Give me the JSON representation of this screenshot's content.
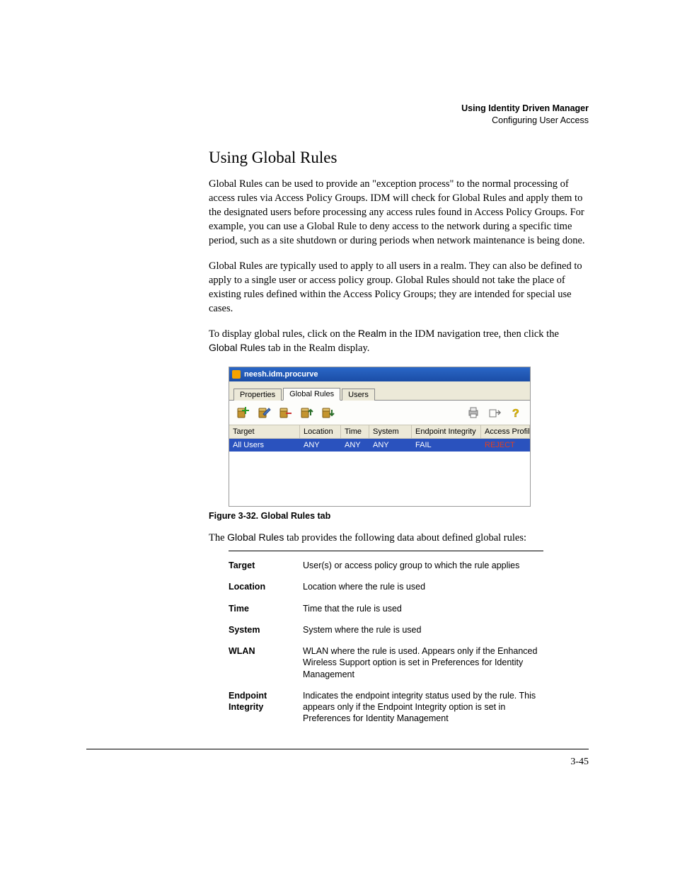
{
  "header": {
    "line1": "Using Identity Driven Manager",
    "line2": "Configuring User Access"
  },
  "section_title": "Using Global Rules",
  "paragraphs": {
    "p1": "Global Rules can be used to provide an \"exception process\" to the normal processing of access rules via Access Policy Groups. IDM will check for Global Rules and apply them to the designated users before processing any access rules found in Access Policy Groups. For example, you can use a Global Rule to deny access to the network during a specific time period, such as a site shutdown or during periods when network maintenance is being done.",
    "p2": "Global Rules are typically used to apply to all users in a realm. They can also be defined to apply to a single user or access policy group. Global Rules should not take the place of existing rules defined within the Access Policy Groups; they are intended for special use cases.",
    "p3a": "To display global rules, click on the ",
    "p3b": "Realm",
    "p3c": " in the IDM navigation tree, then click the ",
    "p3d": "Global Rules",
    "p3e": " tab in the Realm display."
  },
  "screenshot": {
    "window_title": "neesh.idm.procurve",
    "tabs": {
      "properties": "Properties",
      "global_rules": "Global Rules",
      "users": "Users"
    },
    "columns": {
      "target": "Target",
      "location": "Location",
      "time": "Time",
      "system": "System",
      "endpoint_integrity": "Endpoint Integrity",
      "access_profile": "Access Profile"
    },
    "row": {
      "target": "All Users",
      "location": "ANY",
      "time": "ANY",
      "system": "ANY",
      "endpoint_integrity": "FAIL",
      "access_profile": "REJECT"
    }
  },
  "figure_caption": "Figure 3-32. Global Rules tab",
  "intro_after_figure_a": "The ",
  "intro_after_figure_b": "Global Rules",
  "intro_after_figure_c": " tab provides the following data about defined global rules:",
  "defs": [
    {
      "term": "Target",
      "desc": "User(s) or access policy group to which the rule applies"
    },
    {
      "term": "Location",
      "desc": "Location where the rule is used"
    },
    {
      "term": "Time",
      "desc": "Time that the rule is used"
    },
    {
      "term": "System",
      "desc": "System where the rule is used"
    },
    {
      "term": "WLAN",
      "desc": "WLAN where the rule is used. Appears only if the Enhanced Wireless Support option is set in Preferences for Identity Management"
    },
    {
      "term": "Endpoint Integrity",
      "desc": "Indicates the endpoint integrity status used by the rule. This appears only if the Endpoint Integrity option is set in Preferences for Identity Management"
    }
  ],
  "page_number": "3-45"
}
